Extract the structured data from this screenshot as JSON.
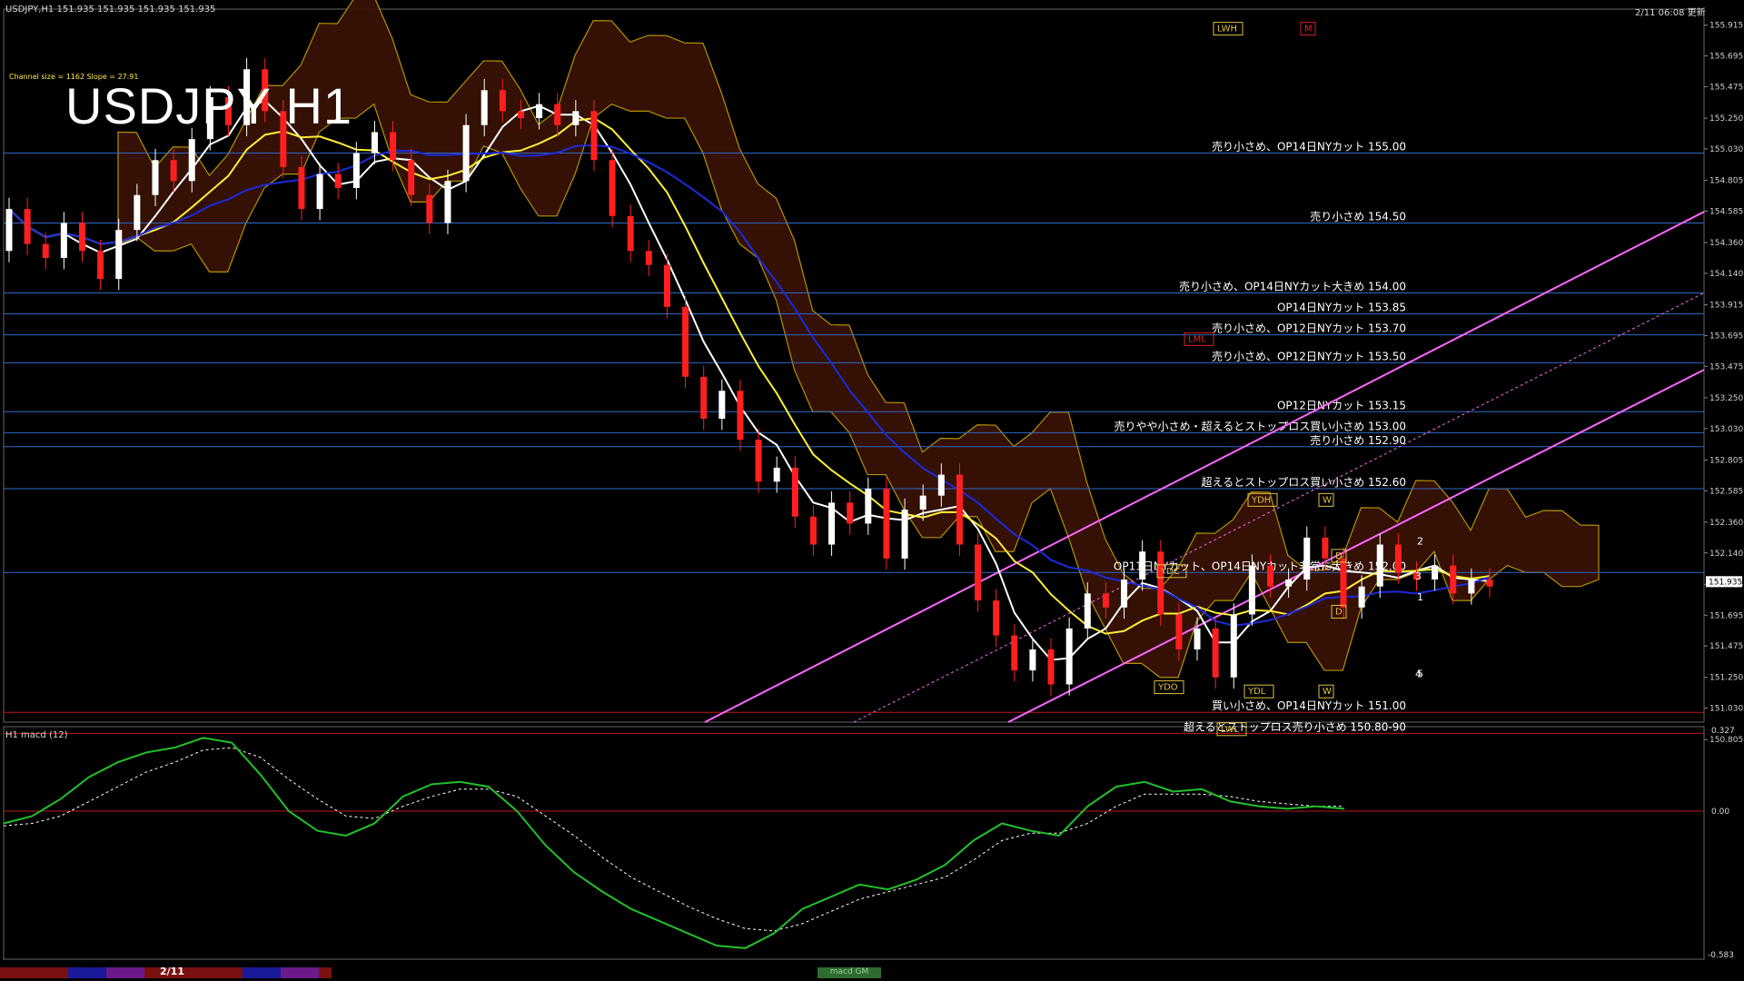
{
  "header": {
    "symbol_info": "USDJPY,H1  151.935 151.935 151.935 151.935",
    "datetime": "2/11 06:08 更新",
    "big_title": "USDJPY H1",
    "channel_info": "Channel size = 1162 Slope = 27.91"
  },
  "indicator_panel": {
    "label": "H1  macd (12)",
    "max_label": "0.327",
    "zero_label": "0.00",
    "min_label": "-0.583"
  },
  "bottom": {
    "date_tab": "2/11",
    "macd_tab": "macd GM"
  },
  "colors": {
    "background": "#000000",
    "level_line": "#2f68c7",
    "channel": "#ff66ff",
    "cloud": "#c9a400",
    "bull": "#ffffff",
    "bear": "#ff1f1f",
    "ma_white": "#ffffff",
    "ma_yellow": "#ffee33",
    "ma_blue": "#1a2be0",
    "rsi_green": "#22c02c"
  },
  "chart_data": {
    "type": "line",
    "title": "USDJPY H1",
    "ylim": [
      150.93,
      156.03
    ],
    "y_ticks": [
      "155.915",
      "155.695",
      "155.475",
      "155.250",
      "155.030",
      "154.805",
      "154.585",
      "154.360",
      "154.140",
      "153.915",
      "153.695",
      "153.475",
      "153.250",
      "153.030",
      "152.805",
      "152.585",
      "152.360",
      "152.140",
      "151.915",
      "151.695",
      "151.475",
      "151.250",
      "151.030",
      "150.805"
    ],
    "current_price": "151.935",
    "price_levels": [
      {
        "label": "売り小さめ、OP14日NYカット 155.00",
        "price": 155.0
      },
      {
        "label": "売り小さめ 154.50",
        "price": 154.5
      },
      {
        "label": "売り小さめ、OP14日NYカット大きめ 154.00",
        "price": 154.0
      },
      {
        "label": "OP14日NYカット 153.85",
        "price": 153.85
      },
      {
        "label": "売り小さめ、OP12日NYカット 153.70",
        "price": 153.7
      },
      {
        "label": "売り小さめ、OP12日NYカット 153.50",
        "price": 153.5
      },
      {
        "label": "OP12日NYカット 153.15",
        "price": 153.15
      },
      {
        "label": "売りやや小さめ・超えるとストップロス買い小さめ 153.00",
        "price": 153.0
      },
      {
        "label": "売り小さめ 152.90",
        "price": 152.9
      },
      {
        "label": "超えるとストップロス買い小さめ 152.60",
        "price": 152.6
      },
      {
        "label": "OP11日NYカット、OP14日NYカット非常に大きめ 152.00",
        "price": 152.0
      },
      {
        "label": "買い小さめ、OP14日NYカット 151.00",
        "price": 151.0
      },
      {
        "label": "超えるとストップロス売り小さめ 150.80-90",
        "price": 150.85
      }
    ],
    "markers": [
      {
        "text": "LWH",
        "price": 155.87
      },
      {
        "text": "M",
        "price": 155.87
      },
      {
        "text": "LML",
        "price": 153.65
      },
      {
        "text": "YDH",
        "price": 152.5
      },
      {
        "text": "W",
        "price": 152.5
      },
      {
        "text": "YDC",
        "price": 151.99
      },
      {
        "text": "D",
        "price": 152.1
      },
      {
        "text": "D",
        "price": 151.7
      },
      {
        "text": "YDO",
        "price": 151.16
      },
      {
        "text": "YDL",
        "price": 151.13
      },
      {
        "text": "W",
        "price": 151.13
      },
      {
        "text": "LWL",
        "price": 150.86
      }
    ],
    "wave_labels": [
      "2",
      "3",
      "1",
      "5",
      "4"
    ],
    "series": [
      {
        "type": "candles",
        "close": [
          154.6,
          154.35,
          154.25,
          154.5,
          154.3,
          154.1,
          154.45,
          154.7,
          154.95,
          154.8,
          155.1,
          155.4,
          155.2,
          155.6,
          155.3,
          154.9,
          154.6,
          154.85,
          154.75,
          155.0,
          155.15,
          154.95,
          154.7,
          154.5,
          154.8,
          155.2,
          155.45,
          155.3,
          155.25,
          155.35,
          155.2,
          155.3,
          154.95,
          154.55,
          154.3,
          154.2,
          153.9,
          153.4,
          153.1,
          153.3,
          152.95,
          152.65,
          152.75,
          152.4,
          152.2,
          152.5,
          152.35,
          152.6,
          152.1,
          152.45,
          152.55,
          152.7,
          152.2,
          151.8,
          151.55,
          151.3,
          151.45,
          151.2,
          151.6,
          151.85,
          151.75,
          151.95,
          152.15,
          151.7,
          151.45,
          151.6,
          151.25,
          151.7,
          152.05,
          151.9,
          151.95,
          152.25,
          152.1,
          151.75,
          151.9,
          152.2,
          152.0,
          151.95,
          152.05,
          151.85,
          151.95,
          151.9
        ],
        "open": [
          154.3,
          154.6,
          154.35,
          154.25,
          154.5,
          154.3,
          154.1,
          154.45,
          154.7,
          154.95,
          154.8,
          155.1,
          155.4,
          155.2,
          155.6,
          155.3,
          154.9,
          154.6,
          154.85,
          154.75,
          155.0,
          155.15,
          154.95,
          154.7,
          154.5,
          154.8,
          155.2,
          155.45,
          155.3,
          155.25,
          155.35,
          155.2,
          155.3,
          154.95,
          154.55,
          154.3,
          154.2,
          153.9,
          153.4,
          153.1,
          153.3,
          152.95,
          152.65,
          152.75,
          152.4,
          152.2,
          152.5,
          152.35,
          152.6,
          152.1,
          152.45,
          152.55,
          152.7,
          152.2,
          151.8,
          151.55,
          151.3,
          151.45,
          151.2,
          151.6,
          151.85,
          151.75,
          151.95,
          152.15,
          151.7,
          151.45,
          151.6,
          151.25,
          151.7,
          152.05,
          151.9,
          151.95,
          152.25,
          152.1,
          151.75,
          151.9,
          152.2,
          152.0,
          151.95,
          152.05,
          151.85,
          151.95
        ]
      }
    ],
    "macd": {
      "main": [
        -0.05,
        -0.02,
        0.05,
        0.14,
        0.2,
        0.24,
        0.26,
        0.3,
        0.28,
        0.15,
        0.0,
        -0.08,
        -0.1,
        -0.05,
        0.06,
        0.11,
        0.12,
        0.1,
        0.0,
        -0.14,
        -0.25,
        -0.33,
        -0.4,
        -0.45,
        -0.5,
        -0.55,
        -0.56,
        -0.5,
        -0.4,
        -0.35,
        -0.3,
        -0.32,
        -0.28,
        -0.22,
        -0.12,
        -0.05,
        -0.08,
        -0.1,
        0.02,
        0.1,
        0.12,
        0.08,
        0.09,
        0.04,
        0.02,
        0.01,
        0.02,
        0.01
      ],
      "signal": [
        -0.06,
        -0.05,
        -0.02,
        0.04,
        0.1,
        0.16,
        0.2,
        0.25,
        0.26,
        0.22,
        0.13,
        0.05,
        -0.02,
        -0.03,
        0.02,
        0.06,
        0.09,
        0.09,
        0.06,
        -0.02,
        -0.1,
        -0.19,
        -0.27,
        -0.33,
        -0.39,
        -0.44,
        -0.48,
        -0.49,
        -0.46,
        -0.41,
        -0.36,
        -0.33,
        -0.3,
        -0.27,
        -0.2,
        -0.12,
        -0.09,
        -0.09,
        -0.05,
        0.02,
        0.07,
        0.07,
        0.07,
        0.06,
        0.04,
        0.03,
        0.02,
        0.02
      ]
    }
  }
}
